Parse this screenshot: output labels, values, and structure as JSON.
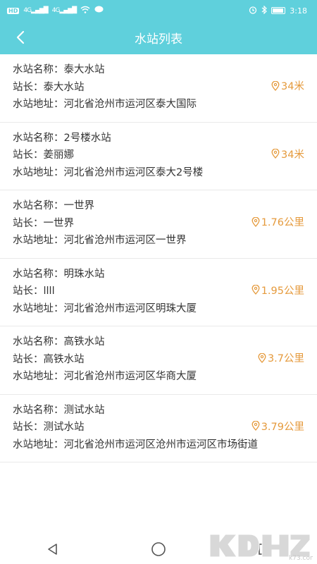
{
  "status_bar": {
    "left_badge": "HD",
    "signal1": "4G",
    "signal2": "4G",
    "time": "3:18"
  },
  "header": {
    "title": "水站列表"
  },
  "stations": [
    {
      "name_label": "水站名称：",
      "name": "泰大水站",
      "manager_label": "站长：",
      "manager": "泰大水站",
      "address_label": "水站地址：",
      "address": "河北省沧州市运河区泰大国际",
      "distance": "34米"
    },
    {
      "name_label": "水站名称：",
      "name": "2号楼水站",
      "manager_label": "站长：",
      "manager": "姜丽娜",
      "address_label": "水站地址：",
      "address": "河北省沧州市运河区泰大2号楼",
      "distance": "34米"
    },
    {
      "name_label": "水站名称：",
      "name": "一世界",
      "manager_label": "站长：",
      "manager": "一世界",
      "address_label": "水站地址：",
      "address": "河北省沧州市运河区一世界",
      "distance": "1.76公里"
    },
    {
      "name_label": "水站名称：",
      "name": "明珠水站",
      "manager_label": "站长：",
      "manager": "llll",
      "address_label": "水站地址：",
      "address": "河北省沧州市运河区明珠大厦",
      "distance": "1.95公里"
    },
    {
      "name_label": "水站名称：",
      "name": "高铁水站",
      "manager_label": "站长：",
      "manager": "高铁水站",
      "address_label": "水站地址：",
      "address": "河北省沧州市运河区华商大厦",
      "distance": "3.7公里"
    },
    {
      "name_label": "水站名称：",
      "name": "测试水站",
      "manager_label": "站长：",
      "manager": "测试水站",
      "address_label": "水站地址：",
      "address": "河北省沧州市运河区沧州市运河区市场街道",
      "distance": "3.79公里"
    }
  ],
  "colors": {
    "header": "#5fd0dc",
    "distance": "#e59a3c"
  },
  "watermark": "k73.com"
}
